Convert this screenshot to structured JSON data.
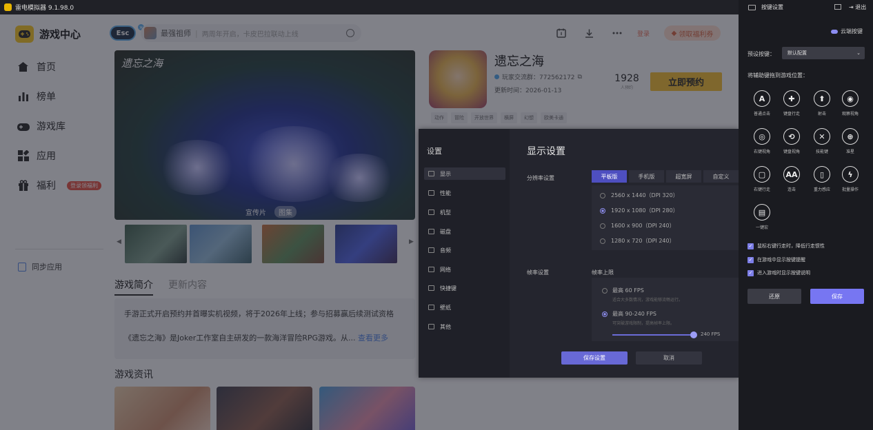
{
  "window": {
    "title": "雷电模拟器 9.1.98.0"
  },
  "sidebar": {
    "brand": "游戏中心",
    "items": [
      {
        "label": "首页"
      },
      {
        "label": "榜单"
      },
      {
        "label": "游戏库"
      },
      {
        "label": "应用"
      },
      {
        "label": "福利",
        "badge": "登录领福利"
      }
    ],
    "sync": "同步应用"
  },
  "topbar": {
    "esc": "Esc",
    "esc_badge": "×",
    "search_game": "最强祖师",
    "search_placeholder": "两周年开启，卡皮巴拉联动上线",
    "login": "登录",
    "welfare": "领取福利券"
  },
  "hero": {
    "logo": "遗忘之海",
    "tabs": [
      "宣传片",
      "图集"
    ],
    "active_tab": "图集"
  },
  "game": {
    "name": "遗忘之海",
    "qq": "玩家交流群：772562172",
    "date": "更新时间：2026-01-13",
    "count": "1928",
    "count_label": "人预约",
    "reserve": "立即预约",
    "tags": [
      "动作",
      "冒险",
      "开放世界",
      "横屏",
      "幻想",
      "欧美卡通"
    ]
  },
  "intro": {
    "tabs": [
      "游戏简介",
      "更新内容"
    ],
    "p1": "手游正式开启预约并首曝实机视频，将于2026年上线；参与招募赢后续测试资格",
    "p2": "《遗忘之海》是Joker工作室自主研发的一款海洋冒险RPG游戏。从...",
    "more": "查看更多"
  },
  "news": {
    "title": "游戏资讯"
  },
  "settings": {
    "nav_title": "设置",
    "nav": [
      "显示",
      "性能",
      "机型",
      "磁盘",
      "音频",
      "网络",
      "快捷键",
      "壁纸",
      "其他"
    ],
    "active_nav": "显示",
    "title": "显示设置",
    "res_label": "分辨率设置",
    "res_tabs": [
      "平板版",
      "手机版",
      "超宽屏",
      "自定义"
    ],
    "res_active": "平板版",
    "res_options": [
      "2560 x 1440（DPI 320）",
      "1920 x 1080（DPI 280）",
      "1600 x 900（DPI 240）",
      "1280 x 720（DPI 240）"
    ],
    "res_selected": "1920 x 1080（DPI 280）",
    "fps_label": "帧率设置",
    "fps_limit": "帧率上限",
    "fps_options": [
      {
        "title": "最高 60 FPS",
        "sub": "适合大多数情况，游戏能够流畅运行。"
      },
      {
        "title": "最高 90-240 FPS",
        "sub": "可突破游戏限制，提高帧率上限。"
      }
    ],
    "fps_selected": "最高 90-240 FPS",
    "fps_slider_value": "240 FPS",
    "fps_slider_fraction": 1.0,
    "save": "保存设置",
    "cancel": "取消"
  },
  "panel": {
    "title": "按键设置",
    "exit": "退出",
    "cloud": "云端按键",
    "preset_label": "预设按键：",
    "preset_value": "默认配置",
    "drag_hint": "将辅助键拖到游戏位置：",
    "keys": [
      {
        "label": "普通点击",
        "icon": "A"
      },
      {
        "label": "键盘行走",
        "icon": "✚"
      },
      {
        "label": "射击",
        "icon": "⬆"
      },
      {
        "label": "观察视角",
        "icon": "◉"
      },
      {
        "label": "右键视角",
        "icon": "◎"
      },
      {
        "label": "键盘视角",
        "icon": "⟲"
      },
      {
        "label": "技能键",
        "icon": "✕"
      },
      {
        "label": "准星",
        "icon": "⊕"
      },
      {
        "label": "右键行走",
        "icon": "▢"
      },
      {
        "label": "连击",
        "icon": "AA"
      },
      {
        "label": "重力感应",
        "icon": "▯"
      },
      {
        "label": "批量操作",
        "icon": "ϟ"
      },
      {
        "label": "一键宏",
        "icon": "▤"
      }
    ],
    "checks": [
      "鼠标右键行走时，降低行走惯性",
      "在游戏中显示按键提醒",
      "进入游戏时显示按键说明"
    ],
    "restore": "还原",
    "save": "保存"
  }
}
